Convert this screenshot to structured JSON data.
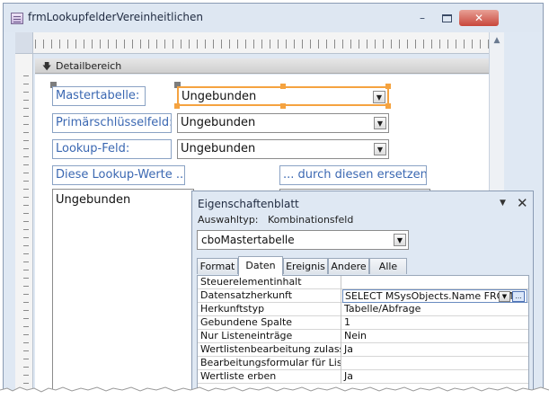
{
  "window": {
    "title": "frmLookupfelderVereinheitlichen",
    "close_glyph": "✕",
    "minimize_glyph": "–"
  },
  "section": {
    "label": "Detailbereich",
    "arrow_glyph": "🡇"
  },
  "form": {
    "labels": {
      "mastertabelle": "Mastertabelle:",
      "primaerschluessel": "Primärschlüsselfeld:",
      "lookup_feld": "Lookup-Feld:",
      "diese_werte": "Diese Lookup-Werte ...",
      "ersetzen": "... durch diesen ersetzen:"
    },
    "combos": {
      "mastertabelle": "Ungebunden",
      "primaerschluessel": "Ungebunden",
      "lookup_feld": "Ungebunden"
    },
    "listbox": "Ungebunden",
    "dropdown_glyph": "▼"
  },
  "property_sheet": {
    "title": "Eigenschaftenblatt",
    "pin_glyph": "▼",
    "close_glyph": "✕",
    "selection_type_label": "Auswahltyp:",
    "selection_type_value": "Kombinationsfeld",
    "object": "cboMastertabelle",
    "tabs": [
      "Format",
      "Daten",
      "Ereignis",
      "Andere",
      "Alle"
    ],
    "active_tab": "Daten",
    "rows": [
      {
        "key": "Steuerelementinhalt",
        "value": ""
      },
      {
        "key": "Datensatzherkunft",
        "value": "SELECT MSysObjects.Name FROM",
        "active": true
      },
      {
        "key": "Herkunftstyp",
        "value": "Tabelle/Abfrage"
      },
      {
        "key": "Gebundene Spalte",
        "value": "1"
      },
      {
        "key": "Nur Listeneinträge",
        "value": "Nein"
      },
      {
        "key": "Wertlistenbearbeitung zulassen",
        "value": "Ja"
      },
      {
        "key": "Bearbeitungsformular für Listenelemente",
        "value": ""
      },
      {
        "key": "Wertliste erben",
        "value": "Ja"
      }
    ],
    "builder_glyph": "..."
  },
  "colors": {
    "label_text": "#3b68b2",
    "selection": "#f5a340",
    "window_bg": "#dfe8f3"
  }
}
